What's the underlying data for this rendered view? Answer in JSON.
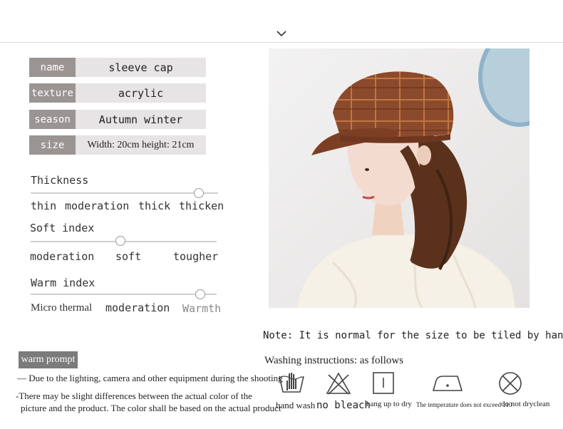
{
  "header": {
    "chevron_icon": "chevron-down-icon"
  },
  "specs": [
    {
      "label": "name",
      "value": "sleeve cap"
    },
    {
      "label": "texture",
      "value": "acrylic"
    },
    {
      "label": "season",
      "value": "Autumn winter"
    },
    {
      "label": "size",
      "value": "Width: 20cm height: 21cm"
    }
  ],
  "scales": {
    "thickness": {
      "title": "Thickness",
      "options": [
        "thin",
        "moderation",
        "thick",
        "thicken"
      ],
      "selected": "thicken"
    },
    "soft": {
      "title": "Soft index",
      "options": [
        "moderation",
        "soft",
        "tougher"
      ],
      "selected": "soft"
    },
    "warm": {
      "title": "Warm index",
      "options": [
        "Micro thermal",
        "moderation",
        "Warmth"
      ],
      "selected": "Warmth"
    }
  },
  "note": "Note: It is normal for the size to be tiled by hand",
  "washing": {
    "title": "Washing instructions: as follows",
    "items": [
      {
        "icon": "hand-wash-icon",
        "label": "hand wash"
      },
      {
        "icon": "no-bleach-icon",
        "label": "no bleach"
      },
      {
        "icon": "hang-dry-icon",
        "label": "hang up to dry"
      },
      {
        "icon": "iron-temperature-icon",
        "label": "The temperature does not exceed 110"
      },
      {
        "icon": "no-dryclean-icon",
        "label": "do not dryclean"
      }
    ]
  },
  "warm_prompt": {
    "label": "warm prompt",
    "line1": "— Due to the lighting, camera and other equipment during the shooting",
    "line2": "-There may be slight differences between the actual color of the",
    "line3": "picture and the product. The color shall be based on the actual product"
  },
  "colors": {
    "label_bg": "#9a9493",
    "value_bg": "#e6e4e4",
    "hat_brown": "#8a4a2c"
  }
}
